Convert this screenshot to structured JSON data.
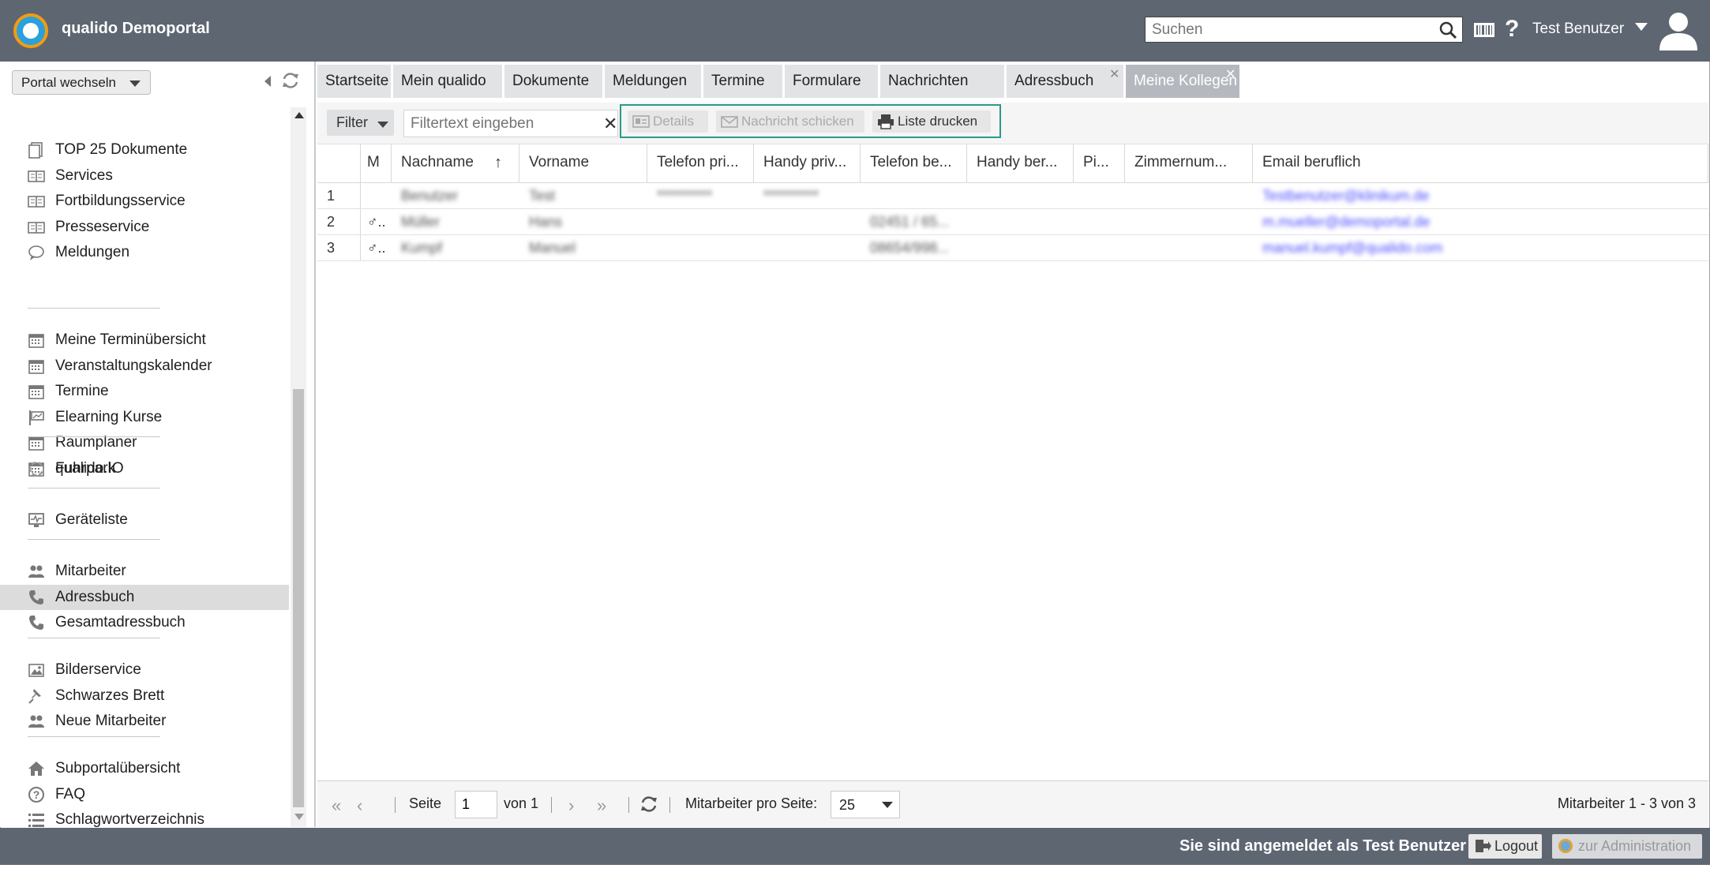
{
  "header": {
    "app_title": "qualido Demoportal",
    "search_placeholder": "Suchen",
    "help_label": "?",
    "user_name": "Test Benutzer"
  },
  "sidebar": {
    "portal_switch_label": "Portal wechseln",
    "groups": [
      [
        {
          "label": "TOP 25 Dokumente",
          "icon": "documents-icon"
        },
        {
          "label": "Services",
          "icon": "book-icon"
        },
        {
          "label": "Fortbildungsservice",
          "icon": "book-icon"
        },
        {
          "label": "Presseservice",
          "icon": "book-icon"
        },
        {
          "label": "Meldungen",
          "icon": "speech-bubble-icon"
        }
      ],
      [
        {
          "label": "Meine Terminübersicht",
          "icon": "calendar-icon"
        },
        {
          "label": "Veranstaltungskalender",
          "icon": "calendar-icon"
        },
        {
          "label": "Termine",
          "icon": "calendar-icon"
        },
        {
          "label": "Elearning Kurse",
          "icon": "presentation-icon"
        },
        {
          "label": "Raumplaner",
          "icon": "calendar-icon"
        },
        {
          "label": "Fuhrpark",
          "icon": "calendar-icon"
        }
      ],
      [
        {
          "label": "qualido.IO",
          "icon": "cycle-icon"
        }
      ],
      [
        {
          "label": "Geräteliste",
          "icon": "monitor-icon"
        }
      ],
      [
        {
          "label": "Mitarbeiter",
          "icon": "people-icon"
        },
        {
          "label": "Adressbuch",
          "icon": "phone-icon",
          "active": true
        },
        {
          "label": "Gesamtadressbuch",
          "icon": "phone-icon"
        }
      ],
      [
        {
          "label": "Bilderservice",
          "icon": "picture-icon"
        },
        {
          "label": "Schwarzes Brett",
          "icon": "pin-icon"
        },
        {
          "label": "Neue Mitarbeiter",
          "icon": "people-icon"
        }
      ],
      [
        {
          "label": "Subportalübersicht",
          "icon": "home-icon"
        },
        {
          "label": "FAQ",
          "icon": "question-icon"
        },
        {
          "label": "Schlagwortverzeichnis",
          "icon": "list-icon"
        }
      ]
    ]
  },
  "tabs": [
    {
      "label": "Startseite"
    },
    {
      "label": "Mein qualido"
    },
    {
      "label": "Dokumente"
    },
    {
      "label": "Meldungen"
    },
    {
      "label": "Termine"
    },
    {
      "label": "Formulare"
    },
    {
      "label": "Nachrichten"
    },
    {
      "label": "Adressbuch",
      "closable": true
    },
    {
      "label": "Meine Kollegen",
      "closable": true,
      "active": true
    }
  ],
  "toolbar": {
    "filter_label": "Filter",
    "filter_placeholder": "Filtertext eingeben",
    "details_label": "Details",
    "message_label": "Nachricht schicken",
    "print_label": "Liste drucken"
  },
  "grid": {
    "columns": [
      "M",
      "Nachname",
      "Vorname",
      "Telefon pri...",
      "Handy priv...",
      "Telefon be...",
      "Handy ber...",
      "Pi...",
      "Zimmernum...",
      "Email beruflich"
    ],
    "rows": [
      {
        "num": "1",
        "gender": "",
        "nachname": "Benutzer",
        "vorname": "Test",
        "tel_priv": "**********",
        "handy_priv": "**********",
        "tel_ber": "",
        "email": "Testbenutzer@klinikum.de"
      },
      {
        "num": "2",
        "gender": "♂..",
        "nachname": "Müller",
        "vorname": "Hans",
        "tel_ber": "02451 / 65...",
        "tel_priv": "",
        "handy_priv": "",
        "email": "m.mueller@demoportal.de"
      },
      {
        "num": "3",
        "gender": "♂..",
        "nachname": "Kumpf",
        "vorname": "Manuel",
        "tel_ber": "08654/998...",
        "tel_priv": "",
        "handy_priv": "",
        "email": "manuel.kumpf@qualido.com"
      }
    ]
  },
  "pager": {
    "page_label": "Seite",
    "page_value": "1",
    "of_label": "von 1",
    "per_page_label": "Mitarbeiter pro Seite:",
    "per_page_value": "25",
    "summary": "Mitarbeiter 1 - 3 von 3"
  },
  "footer": {
    "logged_in_text": "Sie sind angemeldet als Test Benutzer",
    "logout_label": "Logout",
    "admin_label": "zur Administration"
  },
  "colors": {
    "header_bg": "#5e6672",
    "accent_outline": "#2a9a8a",
    "active_tab": "#b5b9bf"
  }
}
